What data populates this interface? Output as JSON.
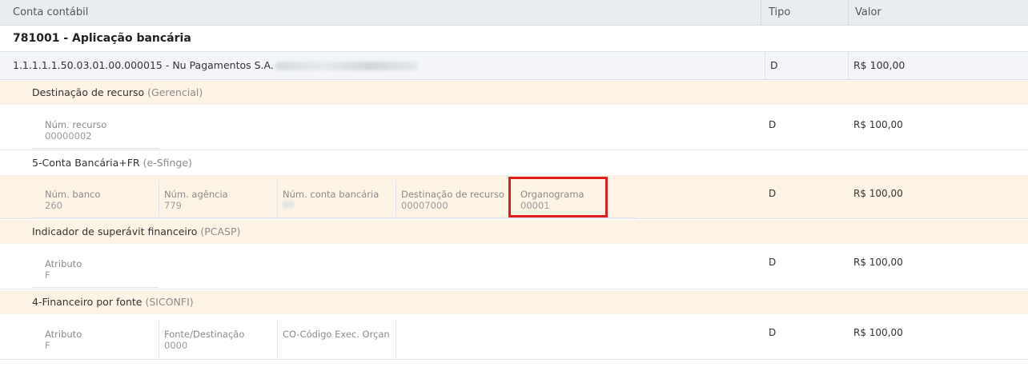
{
  "header": {
    "col_account": "Conta contábil",
    "col_type": "Tipo",
    "col_value": "Valor"
  },
  "group": {
    "title": "781001 - Aplicação bancária"
  },
  "account": {
    "label": "1.1.1.1.1.50.03.01.00.000015 - Nu Pagamentos S.A.",
    "type": "D",
    "value": "R$ 100,00"
  },
  "sections": [
    {
      "title": "Destinação de recurso",
      "subtitle": "(Gerencial)",
      "fields": [
        {
          "label": "Núm. recurso",
          "value": "00000002"
        }
      ],
      "type": "D",
      "value": "R$ 100,00"
    },
    {
      "title": "5-Conta Bancária+FR",
      "subtitle": "(e-Sfinge)",
      "fields": [
        {
          "label": "Núm. banco",
          "value": "260"
        },
        {
          "label": "Núm. agência",
          "value": "779"
        },
        {
          "label": "Núm. conta bancária",
          "value": ""
        },
        {
          "label": "Destinação de recurso",
          "value": "00007000"
        },
        {
          "label": "Organograma",
          "value": "00001"
        }
      ],
      "type": "D",
      "value": "R$ 100,00"
    },
    {
      "title": "Indicador de superávit financeiro",
      "subtitle": "(PCASP)",
      "fields": [
        {
          "label": "Atributo",
          "value": "F"
        }
      ],
      "type": "D",
      "value": "R$ 100,00"
    },
    {
      "title": "4-Financeiro por fonte",
      "subtitle": "(SICONFI)",
      "fields": [
        {
          "label": "Atributo",
          "value": "F"
        },
        {
          "label": "Fonte/Destinação",
          "value": "0000"
        },
        {
          "label": "CO-Código Exec. Orçan",
          "value": ""
        }
      ],
      "type": "D",
      "value": "R$ 100,00"
    }
  ]
}
